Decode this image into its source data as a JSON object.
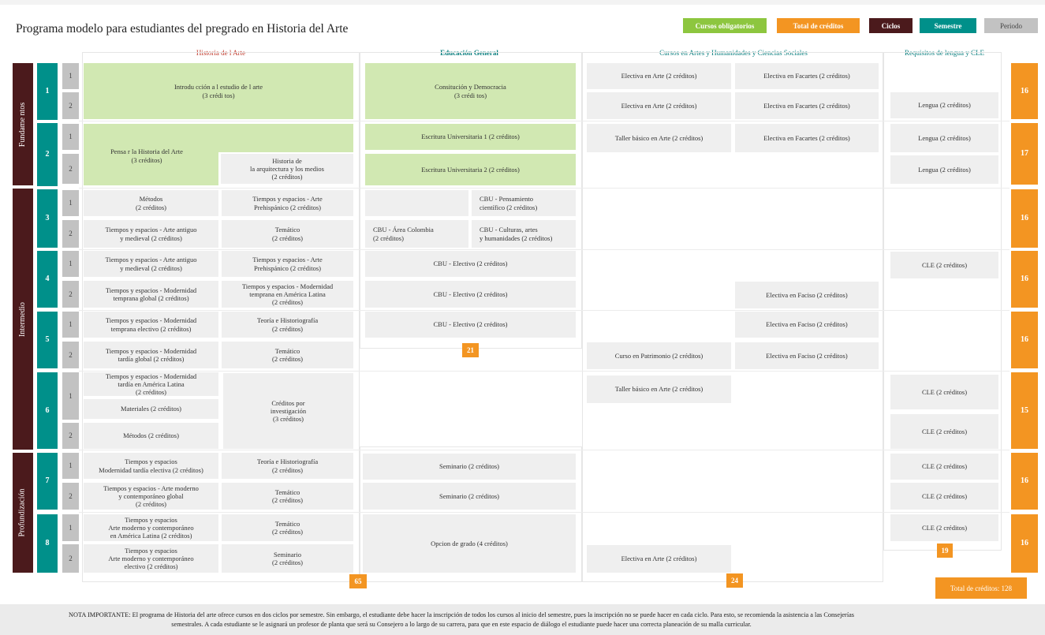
{
  "title": "Programa modelo para estudiantes del pregrado en Historia del Arte",
  "legend": [
    {
      "label": "Cursos obligatorios",
      "color": "#8dc63f"
    },
    {
      "label": "Total de créditos",
      "color": "#f39522"
    },
    {
      "label": "Ciclos",
      "color": "#4b1a1c"
    },
    {
      "label": "Semestre",
      "color": "#00908a"
    },
    {
      "label": "Periodo",
      "color": "#c2c2c2"
    }
  ],
  "columns": {
    "historia": "Historia de l Arte",
    "general": "Educación General",
    "artes": "Cursos en Artes y Humanidades y Ciencias Sociales",
    "lengua": "Requisitos de lengua y CLE"
  },
  "stages": [
    "Fundame ntos",
    "Intermedio",
    "Profundización"
  ],
  "semesters": [
    "1",
    "2",
    "3",
    "4",
    "5",
    "6",
    "7",
    "8"
  ],
  "periods": [
    "1",
    "2"
  ],
  "semester_totals": [
    "16",
    "17",
    "16",
    "16",
    "16",
    "15",
    "16",
    "16"
  ],
  "column_totals": {
    "historia": "65",
    "general": "21",
    "artes": "24",
    "lengua": "19"
  },
  "grand_total": "Total de créditos: 128",
  "historia": {
    "h1": "Introdu cción a l estudio de l arte\n(3 crédi tos)",
    "h2": "Pensa r la Historia del Arte\n(3 créditos)",
    "h3": "Historia de\nla arquitectura y los medios\n(2 créditos)",
    "h4": "Métodos\n(2 créditos)",
    "h5": "Tiempos y espacios - Arte\nPrehispánico (2 créditos)",
    "h6": "Tiempos y espacios - Arte antiguo\ny medieval (2 créditos)",
    "h7": "Temático\n(2 créditos)",
    "h8": "Tiempos y espacios - Arte antiguo\ny medieval (2 créditos)",
    "h9": "Tiempos y espacios - Arte\nPrehispánico (2 créditos)",
    "h10": "Tiempos y espacios - Modernidad\ntemprana global (2 créditos)",
    "h11": "Tiempos y espacios - Modernidad\ntemprana en América Latina\n(2 créditos)",
    "h12": "Tiempos y espacios - Modernidad\ntemprana electivo (2 créditos)",
    "h13": "Teoría e Historiografía\n(2 créditos)",
    "h14": "Tiempos y espacios - Modernidad\ntardía global (2 créditos)",
    "h15": "Temático\n(2 créditos)",
    "h16": "Tiempos y espacios - Modernidad\ntardía en América Latina\n(2 créditos)",
    "h17": "Créditos por\ninvestigación\n(3 créditos)",
    "h18": "Materiales (2 créditos)",
    "h19": "Métodos (2 créditos)",
    "h20": "Tiempos y espacios\nModernidad tardía electiva (2 créditos)",
    "h21": "Teoría e Historiografía\n(2 créditos)",
    "h22": "Tiempos y espacios - Arte moderno\ny contemporáneo global\n(2 créditos)",
    "h23": "Temático\n(2 créditos)",
    "h24": "Tiempos y espacios\nArte moderno y contemporáneo\nen América Latina (2 créditos)",
    "h25": "Temático\n(2 créditos)",
    "h26": "Tiempos y espacios\nArte moderno y contemporáneo\nelectivo (2 créditos)",
    "h27": "Seminario\n(2 créditos)"
  },
  "general": {
    "g1": "Consitución y Democracia\n(3 crédi tos)",
    "g2": "Escritura Universitaria 1 (2 créditos)",
    "g3": "Escritura Universitaria 2 (2 créditos)",
    "g4": "CBU - Pensamiento\ncientífico (2 créditos)",
    "g5": "CBU - Área Colombia\n(2 créditos)",
    "g6": "CBU - Culturas, artes\ny humanidades (2 créditos)",
    "g7": "CBU - Electivo (2 créditos)",
    "g8": "CBU - Electivo (2 créditos)",
    "g9": "CBU - Electivo (2 créditos)",
    "g10": "Seminario (2 créditos)",
    "g11": "Seminario (2 créditos)",
    "g12": "Opcion de grado (4 créditos)"
  },
  "artes": {
    "a1": "Electiva en Arte (2 créditos)",
    "a2": "Electiva en Facartes (2 créditos)",
    "a3": "Electiva en Arte (2 créditos)",
    "a4": "Electiva en Facartes (2 créditos)",
    "a5": "Taller básico en Arte (2 créditos)",
    "a6": "Electiva en Facartes (2 créditos)",
    "a7": "Electiva en Faciso (2 créditos)",
    "a8": "Electiva en Faciso (2 créditos)",
    "a9": "Curso en Patrimonio (2 créditos)",
    "a10": "Electiva en Faciso (2 créditos)",
    "a11": "Taller básico en Arte (2 créditos)",
    "a12": "Electiva en Arte (2 créditos)"
  },
  "lengua": {
    "l1": "Lengua (2 créditos)",
    "l2": "Lengua (2 créditos)",
    "l3": "Lengua (2 créditos)",
    "l4": "CLE (2 créditos)",
    "l5": "CLE (2 créditos)",
    "l6": "CLE (2 créditos)",
    "l7": "CLE (2 créditos)",
    "l8": "CLE (2 créditos)",
    "l9": "CLE (2 créditos)"
  },
  "note": "NOTA IMPORTANTE: El programa de Historia del arte ofrece cursos en dos ciclos por semestre. Sin embargo, el estudiante debe hacer la inscripción de todos los cursos al inicio del semestre, pues la inscripción no se puede hacer en cada ciclo. Para esto, se recomienda la asistencia a las Consejerías semestrales. A cada estudiante se le asignará un profesor de planta que será su Consejero a lo largo de su carrera, para que en este espacio de diálogo el estudiante puede hacer una correcta planeación de su malla curricular."
}
